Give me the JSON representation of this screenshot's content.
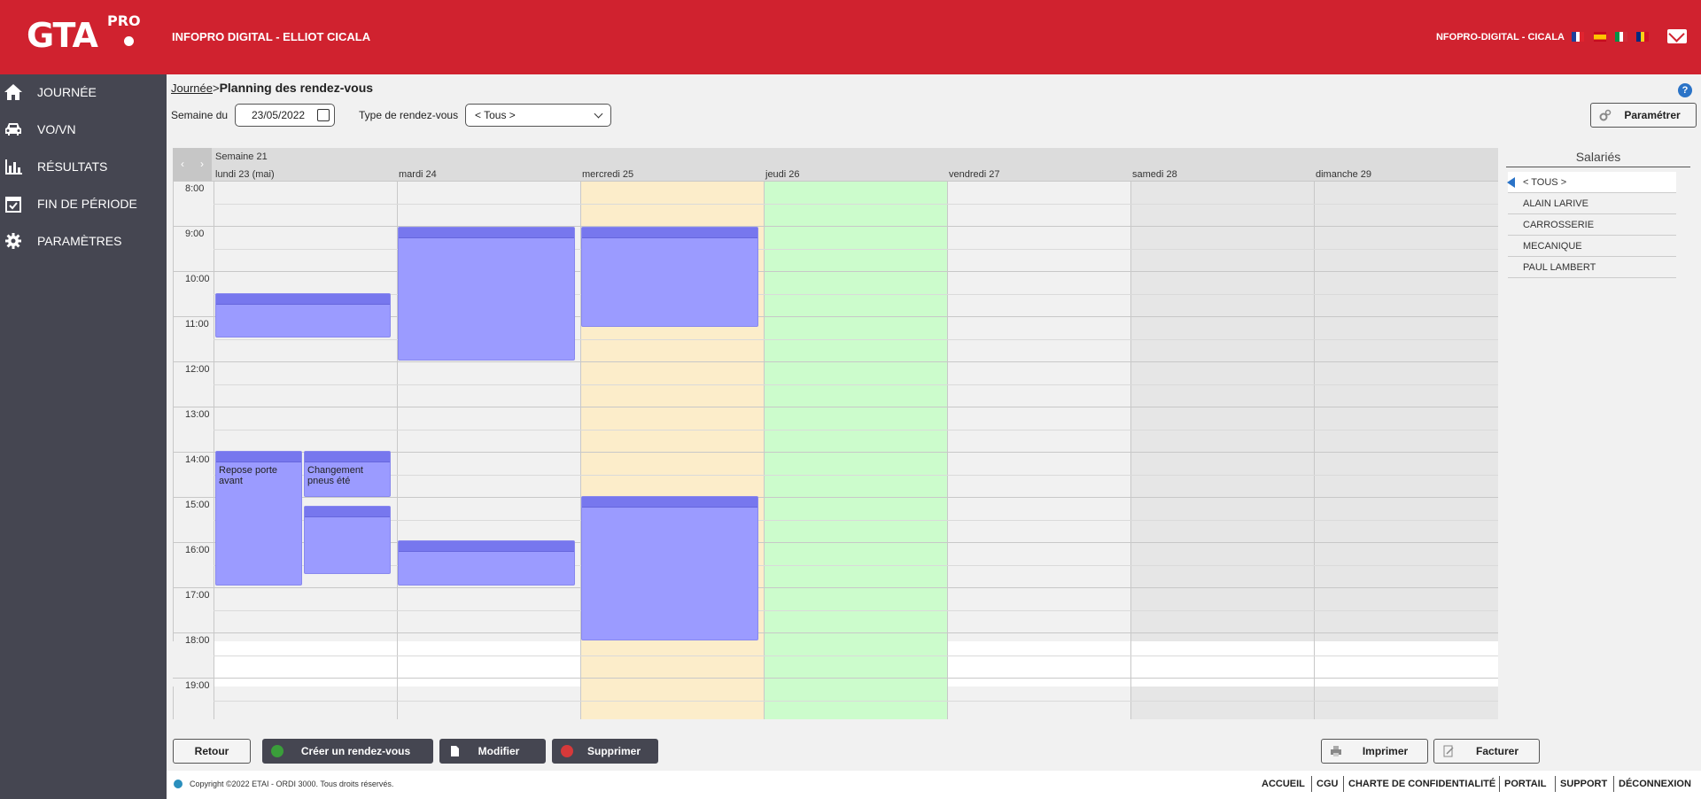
{
  "header": {
    "logo": "GTA",
    "logo_sup": "PRO",
    "company": "INFOPRO DIGITAL - ELLIOT CICALA",
    "user": "NFOPRO-DIGITAL - CICALA"
  },
  "sidebar": {
    "items": [
      {
        "label": "JOURNÉE",
        "icon": "home-icon"
      },
      {
        "label": "VO/VN",
        "icon": "car-icon"
      },
      {
        "label": "RÉSULTATS",
        "icon": "bar-chart-icon"
      },
      {
        "label": "FIN DE PÉRIODE",
        "icon": "calendar-check-icon"
      },
      {
        "label": "PARAMÈTRES",
        "icon": "gear-icon"
      }
    ]
  },
  "breadcrumb": {
    "link": "Journée",
    "sep": ">",
    "title": "Planning des rendez-vous"
  },
  "filters": {
    "week_label": "Semaine du",
    "week_value": "23/05/2022",
    "type_label": "Type de rendez-vous",
    "type_value": "< Tous >"
  },
  "buttons": {
    "parametrer": "Paramétrer",
    "retour": "Retour",
    "creer": "Créer un rendez-vous",
    "modifier": "Modifier",
    "supprimer": "Supprimer",
    "imprimer": "Imprimer",
    "facturer": "Facturer"
  },
  "calendar": {
    "week": "Semaine 21",
    "prev": "‹",
    "next": "›",
    "days": [
      "lundi 23 (mai)",
      "mardi 24",
      "mercredi 25",
      "jeudi 26",
      "vendredi 27",
      "samedi 28",
      "dimanche 29"
    ],
    "hours": [
      "8:00",
      "9:00",
      "10:00",
      "11:00",
      "12:00",
      "13:00",
      "14:00",
      "15:00",
      "16:00",
      "17:00",
      "18:00",
      "19:00"
    ],
    "colors": {
      "wed": "#fcedca",
      "thu": "#ccfccc",
      "weekend": "#e6e6e6",
      "appt": "#9b9bff"
    },
    "appointments": [
      {
        "day": 0,
        "text": ""
      },
      {
        "day": 1,
        "text": ""
      },
      {
        "day": 2,
        "text": ""
      },
      {
        "day": 0,
        "text": "Repose porte avant"
      },
      {
        "day": 0,
        "text": "Changement pneus été"
      },
      {
        "day": 0,
        "text": ""
      },
      {
        "day": 1,
        "text": ""
      },
      {
        "day": 2,
        "text": ""
      }
    ]
  },
  "salaries": {
    "title": "Salariés",
    "items": [
      "< TOUS >",
      "ALAIN LARIVE",
      "CARROSSERIE",
      "MECANIQUE",
      "PAUL LAMBERT"
    ]
  },
  "footer": {
    "copyright": "Copyright ©2022 ETAI - ORDI 3000. Tous droits réservés.",
    "links": [
      "ACCUEIL",
      "CGU",
      "CHARTE DE CONFIDENTIALITÉ",
      "PORTAIL",
      "SUPPORT",
      "DÉCONNEXION"
    ]
  }
}
